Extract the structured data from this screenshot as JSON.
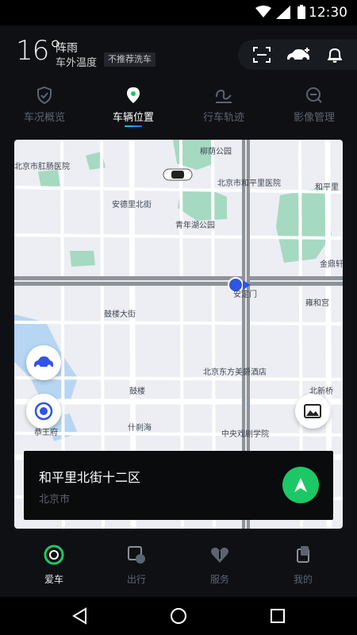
{
  "status_bar": {
    "time": "12:30",
    "icons": [
      "wifi-icon",
      "signal-icon",
      "battery-icon"
    ]
  },
  "weather": {
    "temperature": "16°",
    "condition": "阵雨",
    "label": "车外温度",
    "wash_badge": "不推荐洗车"
  },
  "top_actions": [
    "scan-icon",
    "add-car-icon",
    "bell-icon"
  ],
  "tabs": [
    {
      "label": "车况概览",
      "icon": "shield-check-icon",
      "active": false
    },
    {
      "label": "车辆位置",
      "icon": "location-pin-icon",
      "active": true
    },
    {
      "label": "行车轨迹",
      "icon": "track-icon",
      "active": false
    },
    {
      "label": "影像管理",
      "icon": "camera-icon",
      "active": false
    }
  ],
  "map": {
    "labels": {
      "anorectal_hospital": "北京市肛肠医院",
      "liuyin_park": "柳荫公园",
      "hepingli_hospital": "北京市和平里医院",
      "hepingli_n": "和平里",
      "andeli_beijie": "安德里北街",
      "qingnianhu_park": "青年湖公园",
      "jinding": "金鼎轩",
      "andingmen": "安定门",
      "yonghegong": "雍和宫",
      "gulou_dajie": "鼓楼大街",
      "beijing_dongfang": "北京东方美爵酒店",
      "beixinqiao": "北新桥",
      "gulou": "鼓楼",
      "shichahai": "什刹海",
      "gongwangfu": "恭王府",
      "drama_academy": "中央戏剧学院"
    }
  },
  "map_buttons": [
    "car-locate-icon",
    "my-location-icon",
    "photo-icon"
  ],
  "location_card": {
    "name": "和平里北街十二区",
    "city": "北京市",
    "navigate_icon": "navigate-arrow-icon"
  },
  "bottom_nav": [
    {
      "label": "爱车",
      "icon": "car-ring-icon",
      "active": true
    },
    {
      "label": "出行",
      "icon": "travel-icon",
      "active": false
    },
    {
      "label": "服务",
      "icon": "heart-service-icon",
      "active": false
    },
    {
      "label": "我的",
      "icon": "profile-icon",
      "active": false
    }
  ],
  "system_nav": [
    "back-icon",
    "home-icon",
    "recents-icon"
  ],
  "colors": {
    "accent": "#1cc865",
    "tab_indicator": "#2f6bff",
    "marker": "#2f55e6",
    "background": "#0e1014"
  }
}
